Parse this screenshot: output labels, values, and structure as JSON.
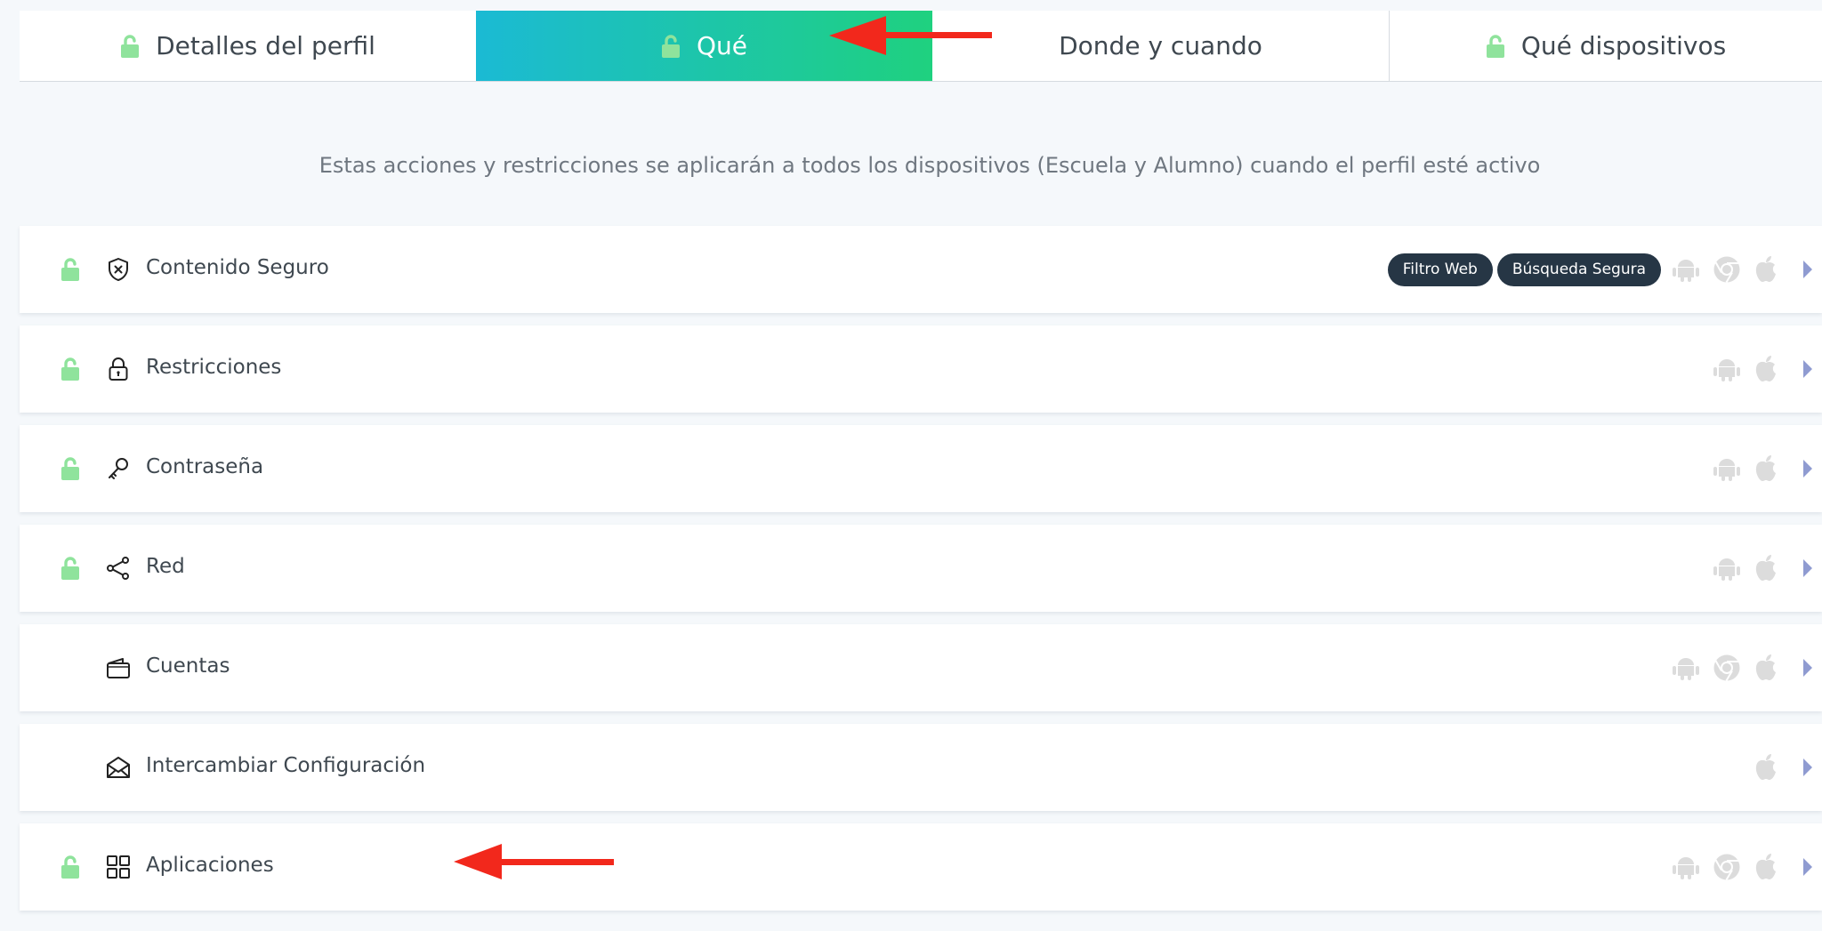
{
  "tabs": [
    {
      "label": "Detalles del perfil",
      "lock": true
    },
    {
      "label": "Qué",
      "lock": true,
      "active": true
    },
    {
      "label": "Donde y cuando",
      "lock": false
    },
    {
      "label": "Qué dispositivos",
      "lock": true
    }
  ],
  "subtitle": "Estas acciones y restricciones se aplicarán a todos los dispositivos (Escuela y Alumno) cuando el perfil esté activo",
  "rows": [
    {
      "label": "Contenido Seguro",
      "icon": "shield-x-icon",
      "unlocked": true,
      "badges": [
        "Filtro Web",
        "Búsqueda Segura"
      ],
      "platforms": [
        "android",
        "chrome",
        "apple"
      ]
    },
    {
      "label": "Restricciones",
      "icon": "padlock-icon",
      "unlocked": true,
      "badges": [],
      "platforms": [
        "android",
        "apple"
      ]
    },
    {
      "label": "Contraseña",
      "icon": "key-icon",
      "unlocked": true,
      "badges": [],
      "platforms": [
        "android",
        "apple"
      ]
    },
    {
      "label": "Red",
      "icon": "share-network-icon",
      "unlocked": true,
      "badges": [],
      "platforms": [
        "android",
        "apple"
      ]
    },
    {
      "label": "Cuentas",
      "icon": "wallet-icon",
      "unlocked": false,
      "badges": [],
      "platforms": [
        "android",
        "chrome",
        "apple"
      ]
    },
    {
      "label": "Intercambiar Configuración",
      "icon": "envelope-open-icon",
      "unlocked": false,
      "badges": [],
      "platforms": [
        "apple"
      ]
    },
    {
      "label": "Aplicaciones",
      "icon": "apps-grid-icon",
      "unlocked": true,
      "badges": [],
      "platforms": [
        "android",
        "chrome",
        "apple"
      ]
    }
  ],
  "colors": {
    "accent_gradient_start": "#1bbad4",
    "accent_gradient_end": "#1fd17f",
    "lock_green": "#8fe39c",
    "badge_bg": "#263645",
    "platform_gray": "#dcdcdc",
    "chevron": "#8f9bd1",
    "annotation_arrow": "#f2281c"
  }
}
